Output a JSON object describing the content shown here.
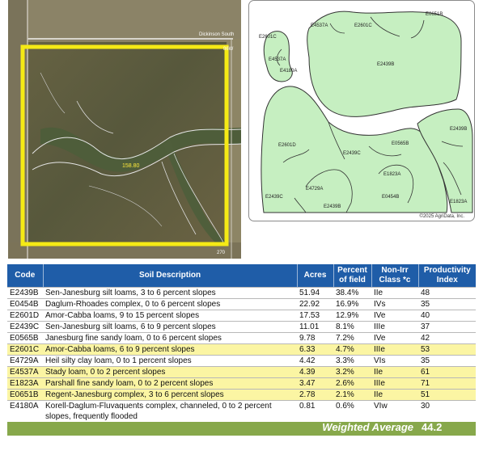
{
  "aerial": {
    "road_label": "Dickinson South",
    "road_label_2": "86W",
    "field_acres": "158.80",
    "corner_label": "270"
  },
  "soil_map": {
    "codes": [
      "E2601C",
      "E4537A",
      "E4180A",
      "E4537A",
      "E2601C",
      "E0651B",
      "E2439B",
      "E2439B",
      "E2601D",
      "E2439C",
      "E0565B",
      "E1823A",
      "E4729A",
      "E0454B",
      "E2439C",
      "E2439B",
      "E1823A"
    ],
    "copyright": "©2025 AgriData, Inc."
  },
  "table": {
    "headers": [
      "Code",
      "Soil Description",
      "Acres",
      "Percent of field",
      "Non-Irr Class *c",
      "Productivity Index"
    ],
    "highlight_color": "#fbf5a3",
    "header_color": "#1f5da8",
    "rows": [
      {
        "code": "E2439B",
        "desc": "Sen-Janesburg silt loams, 3 to 6 percent slopes",
        "acres": "51.94",
        "pct": "38.4%",
        "cls": "IIe",
        "pi": "48",
        "hl": false
      },
      {
        "code": "E0454B",
        "desc": "Daglum-Rhoades complex, 0 to 6 percent slopes",
        "acres": "22.92",
        "pct": "16.9%",
        "cls": "IVs",
        "pi": "35",
        "hl": false
      },
      {
        "code": "E2601D",
        "desc": "Amor-Cabba loams, 9 to 15 percent slopes",
        "acres": "17.53",
        "pct": "12.9%",
        "cls": "IVe",
        "pi": "40",
        "hl": false
      },
      {
        "code": "E2439C",
        "desc": "Sen-Janesburg silt loams, 6 to 9 percent slopes",
        "acres": "11.01",
        "pct": "8.1%",
        "cls": "IIIe",
        "pi": "37",
        "hl": false
      },
      {
        "code": "E0565B",
        "desc": "Janesburg fine sandy loam, 0 to 6 percent slopes",
        "acres": "9.78",
        "pct": "7.2%",
        "cls": "IVe",
        "pi": "42",
        "hl": false
      },
      {
        "code": "E2601C",
        "desc": "Amor-Cabba loams, 6 to 9 percent slopes",
        "acres": "6.33",
        "pct": "4.7%",
        "cls": "IIIe",
        "pi": "53",
        "hl": true
      },
      {
        "code": "E4729A",
        "desc": "Heil silty clay loam, 0 to 1 percent slopes",
        "acres": "4.42",
        "pct": "3.3%",
        "cls": "VIs",
        "pi": "35",
        "hl": false
      },
      {
        "code": "E4537A",
        "desc": "Stady loam, 0 to 2 percent slopes",
        "acres": "4.39",
        "pct": "3.2%",
        "cls": "IIe",
        "pi": "61",
        "hl": true
      },
      {
        "code": "E1823A",
        "desc": "Parshall fine sandy loam, 0 to 2 percent slopes",
        "acres": "3.47",
        "pct": "2.6%",
        "cls": "IIIe",
        "pi": "71",
        "hl": true
      },
      {
        "code": "E0651B",
        "desc": "Regent-Janesburg complex, 3 to 6 percent slopes",
        "acres": "2.78",
        "pct": "2.1%",
        "cls": "IIe",
        "pi": "51",
        "hl": true
      },
      {
        "code": "E4180A",
        "desc": "Korell-Daglum-Fluvaquents complex, channeled, 0 to 2 percent slopes, frequently flooded",
        "acres": "0.81",
        "pct": "0.6%",
        "cls": "VIw",
        "pi": "30",
        "hl": false
      }
    ],
    "weighted_label": "Weighted Average",
    "weighted_value": "44.2"
  }
}
